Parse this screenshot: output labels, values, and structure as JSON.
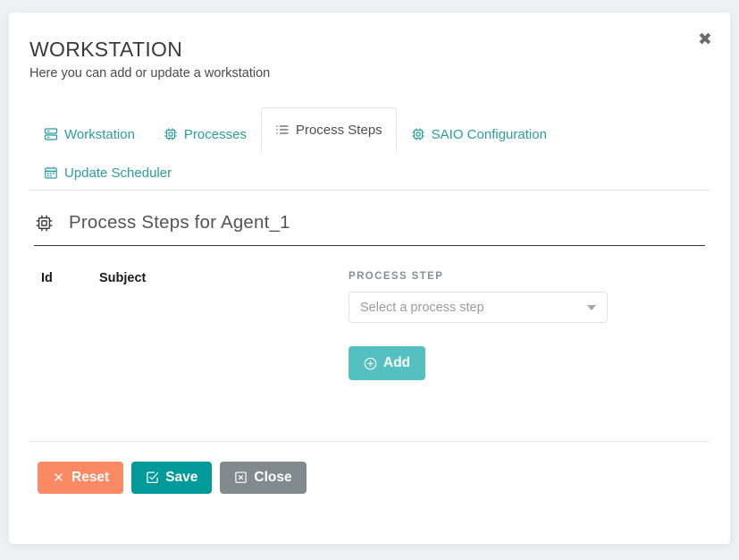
{
  "modal": {
    "close_icon": "close-x-icon",
    "title": "WORKSTATION",
    "subtitle": "Here you can add or update a workstation"
  },
  "tabs": [
    {
      "label": "Workstation",
      "icon": "server-stack-icon",
      "active": false
    },
    {
      "label": "Processes",
      "icon": "microchip-icon",
      "active": false
    },
    {
      "label": "Process Steps",
      "icon": "list-icon",
      "active": true
    },
    {
      "label": "SAIO Configuration",
      "icon": "microchip-icon",
      "active": false
    },
    {
      "label": "Update Scheduler",
      "icon": "calendar-icon",
      "active": false
    }
  ],
  "section": {
    "icon": "microchip-icon",
    "title": "Process Steps for Agent_1"
  },
  "table": {
    "columns": [
      "Id",
      "Subject"
    ],
    "rows": []
  },
  "form": {
    "process_step": {
      "label": "PROCESS STEP",
      "placeholder": "Select a process step",
      "value": "",
      "caret_icon": "chevron-down-icon"
    },
    "add_button": {
      "label": "Add",
      "icon": "plus-circle-icon"
    }
  },
  "footer": {
    "buttons": [
      {
        "label": "Reset",
        "icon": "x-icon",
        "color": "#f98a63"
      },
      {
        "label": "Save",
        "icon": "check-box-icon",
        "color": "#009a9a"
      },
      {
        "label": "Close",
        "icon": "x-box-icon",
        "color": "#818a8f"
      }
    ]
  },
  "colors": {
    "tab_link": "#2a9d9d",
    "add_button": "#55c0c0",
    "save_button": "#009a9a",
    "reset_button": "#f98a63",
    "close_button": "#818a8f",
    "page_background": "#eef0f1"
  }
}
